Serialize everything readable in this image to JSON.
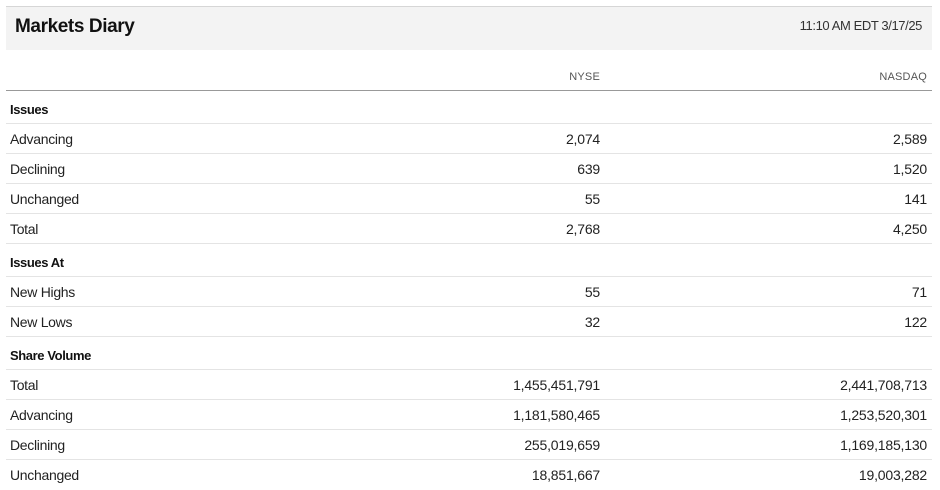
{
  "header": {
    "title": "Markets Diary",
    "timestamp": "11:10 AM EDT 3/17/25"
  },
  "columns": {
    "nyse": "NYSE",
    "nasdaq": "NASDAQ"
  },
  "sections": [
    {
      "label": "Issues",
      "rows": [
        {
          "label": "Advancing",
          "nyse": "2,074",
          "nasdaq": "2,589"
        },
        {
          "label": "Declining",
          "nyse": "639",
          "nasdaq": "1,520"
        },
        {
          "label": "Unchanged",
          "nyse": "55",
          "nasdaq": "141"
        },
        {
          "label": "Total",
          "nyse": "2,768",
          "nasdaq": "4,250"
        }
      ]
    },
    {
      "label": "Issues At",
      "rows": [
        {
          "label": "New Highs",
          "nyse": "55",
          "nasdaq": "71"
        },
        {
          "label": "New Lows",
          "nyse": "32",
          "nasdaq": "122"
        }
      ]
    },
    {
      "label": "Share Volume",
      "rows": [
        {
          "label": "Total",
          "nyse": "1,455,451,791",
          "nasdaq": "2,441,708,713"
        },
        {
          "label": "Advancing",
          "nyse": "1,181,580,465",
          "nasdaq": "1,253,520,301"
        },
        {
          "label": "Declining",
          "nyse": "255,019,659",
          "nasdaq": "1,169,185,130"
        },
        {
          "label": "Unchanged",
          "nyse": "18,851,667",
          "nasdaq": "19,003,282"
        }
      ]
    }
  ]
}
